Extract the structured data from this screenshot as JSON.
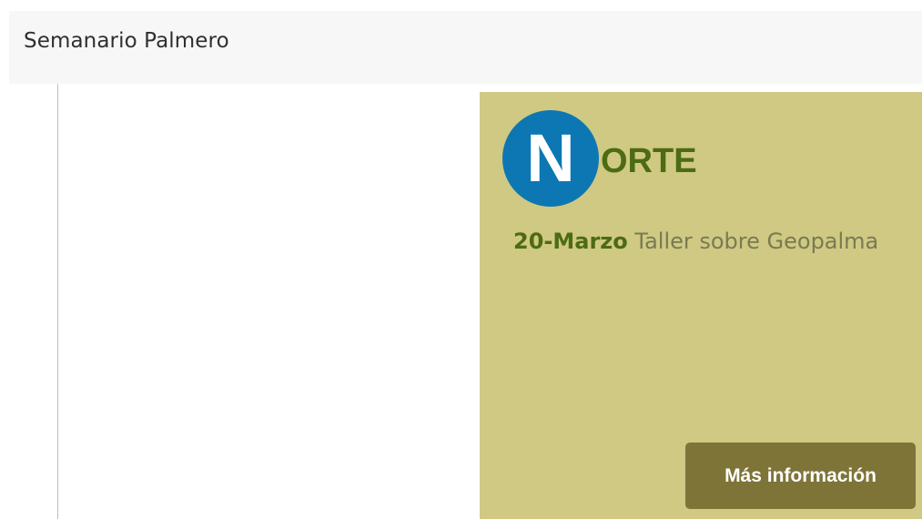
{
  "header": {
    "title": "Semanario Palmero"
  },
  "card": {
    "background_color": "#cfc983",
    "logo": {
      "letter": "N",
      "rest": "ORTE",
      "circle_color": "#0d77b3",
      "letter_color": "#ffffff",
      "text_color": "#4d6b13"
    },
    "event": {
      "date": "20-Marzo",
      "description": "Taller sobre Geopalma",
      "date_color": "#4d6b13",
      "text_color": "#7a7a52"
    },
    "button": {
      "label": "Más información",
      "background_color": "#7e7438",
      "text_color": "#ffffff"
    }
  }
}
